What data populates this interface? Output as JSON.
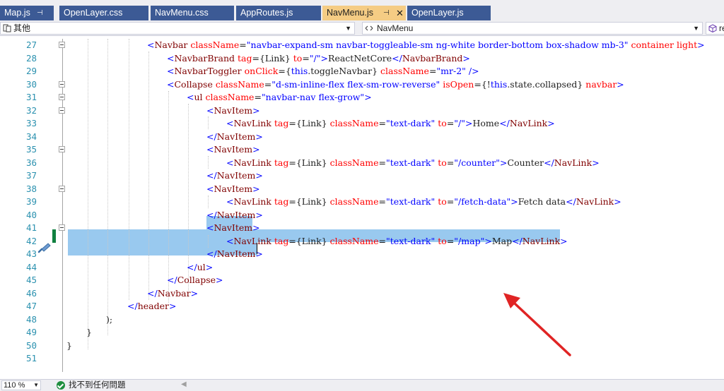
{
  "tabs": [
    {
      "label": "Map.js",
      "pinned": true,
      "active": false
    },
    {
      "label": "OpenLayer.css",
      "pinned": false,
      "active": false
    },
    {
      "label": "NavMenu.css",
      "pinned": false,
      "active": false
    },
    {
      "label": "AppRoutes.js",
      "pinned": false,
      "active": false
    },
    {
      "label": "NavMenu.js",
      "pinned": true,
      "active": true
    },
    {
      "label": "OpenLayer.js",
      "pinned": false,
      "active": false
    }
  ],
  "tab_glyphs": {
    "pin": "⊣",
    "close": "✕"
  },
  "navbar": {
    "project": "其他",
    "member": "NavMenu",
    "right": "re"
  },
  "code_lines": [
    {
      "n": "27",
      "fold": true,
      "tokens": [
        [
          "b",
          "<"
        ],
        [
          "tag",
          "Navbar"
        ],
        [
          "pn",
          " "
        ],
        [
          "attr",
          "className"
        ],
        [
          "pn",
          "="
        ],
        [
          "str",
          "\"navbar-expand-sm navbar-toggleable-sm ng-white border-bottom box-shadow mb-3\""
        ],
        [
          "pn",
          " "
        ],
        [
          "attr",
          "container"
        ],
        [
          "pn",
          " "
        ],
        [
          "attr",
          "light"
        ],
        [
          "b",
          ">"
        ]
      ]
    },
    {
      "n": "28",
      "fold": false,
      "tokens": [
        [
          "b",
          "<"
        ],
        [
          "tag",
          "NavbarBrand"
        ],
        [
          "pn",
          " "
        ],
        [
          "attr",
          "tag"
        ],
        [
          "pn",
          "={Link} "
        ],
        [
          "attr",
          "to"
        ],
        [
          "pn",
          "="
        ],
        [
          "str",
          "\"/\""
        ],
        [
          "b",
          ">"
        ],
        [
          "txt",
          "ReactNetCore"
        ],
        [
          "b",
          "</"
        ],
        [
          "tag",
          "NavbarBrand"
        ],
        [
          "b",
          ">"
        ]
      ]
    },
    {
      "n": "29",
      "fold": false,
      "tokens": [
        [
          "b",
          "<"
        ],
        [
          "tag",
          "NavbarToggler"
        ],
        [
          "pn",
          " "
        ],
        [
          "attr",
          "onClick"
        ],
        [
          "pn",
          "={"
        ],
        [
          "kw",
          "this"
        ],
        [
          "pn",
          ".toggleNavbar} "
        ],
        [
          "attr",
          "className"
        ],
        [
          "pn",
          "="
        ],
        [
          "str",
          "\"mr-2\""
        ],
        [
          "pn",
          " "
        ],
        [
          "b",
          "/>"
        ]
      ]
    },
    {
      "n": "30",
      "fold": true,
      "tokens": [
        [
          "b",
          "<"
        ],
        [
          "tag",
          "Collapse"
        ],
        [
          "pn",
          " "
        ],
        [
          "attr",
          "className"
        ],
        [
          "pn",
          "="
        ],
        [
          "str",
          "\"d-sm-inline-flex flex-sm-row-reverse\""
        ],
        [
          "pn",
          " "
        ],
        [
          "attr",
          "isOpen"
        ],
        [
          "pn",
          "={!"
        ],
        [
          "kw",
          "this"
        ],
        [
          "pn",
          ".state.collapsed} "
        ],
        [
          "attr",
          "navbar"
        ],
        [
          "b",
          ">"
        ]
      ]
    },
    {
      "n": "31",
      "fold": true,
      "tokens": [
        [
          "b",
          "<"
        ],
        [
          "tag",
          "ul"
        ],
        [
          "pn",
          " "
        ],
        [
          "attr",
          "className"
        ],
        [
          "pn",
          "="
        ],
        [
          "str",
          "\"navbar-nav flex-grow\""
        ],
        [
          "b",
          ">"
        ]
      ]
    },
    {
      "n": "32",
      "fold": true,
      "tokens": [
        [
          "b",
          "<"
        ],
        [
          "tag",
          "NavItem"
        ],
        [
          "b",
          ">"
        ]
      ]
    },
    {
      "n": "33",
      "fold": false,
      "tokens": [
        [
          "b",
          "<"
        ],
        [
          "tag",
          "NavLink"
        ],
        [
          "pn",
          " "
        ],
        [
          "attr",
          "tag"
        ],
        [
          "pn",
          "={Link} "
        ],
        [
          "attr",
          "className"
        ],
        [
          "pn",
          "="
        ],
        [
          "str",
          "\"text-dark\""
        ],
        [
          "pn",
          " "
        ],
        [
          "attr",
          "to"
        ],
        [
          "pn",
          "="
        ],
        [
          "str",
          "\"/\""
        ],
        [
          "b",
          ">"
        ],
        [
          "txt",
          "Home"
        ],
        [
          "b",
          "</"
        ],
        [
          "tag",
          "NavLink"
        ],
        [
          "b",
          ">"
        ]
      ]
    },
    {
      "n": "34",
      "fold": false,
      "tokens": [
        [
          "b",
          "</"
        ],
        [
          "tag",
          "NavItem"
        ],
        [
          "b",
          ">"
        ]
      ]
    },
    {
      "n": "35",
      "fold": true,
      "tokens": [
        [
          "b",
          "<"
        ],
        [
          "tag",
          "NavItem"
        ],
        [
          "b",
          ">"
        ]
      ]
    },
    {
      "n": "36",
      "fold": false,
      "tokens": [
        [
          "b",
          "<"
        ],
        [
          "tag",
          "NavLink"
        ],
        [
          "pn",
          " "
        ],
        [
          "attr",
          "tag"
        ],
        [
          "pn",
          "={Link} "
        ],
        [
          "attr",
          "className"
        ],
        [
          "pn",
          "="
        ],
        [
          "str",
          "\"text-dark\""
        ],
        [
          "pn",
          " "
        ],
        [
          "attr",
          "to"
        ],
        [
          "pn",
          "="
        ],
        [
          "str",
          "\"/counter\""
        ],
        [
          "b",
          ">"
        ],
        [
          "txt",
          "Counter"
        ],
        [
          "b",
          "</"
        ],
        [
          "tag",
          "NavLink"
        ],
        [
          "b",
          ">"
        ]
      ]
    },
    {
      "n": "37",
      "fold": false,
      "tokens": [
        [
          "b",
          "</"
        ],
        [
          "tag",
          "NavItem"
        ],
        [
          "b",
          ">"
        ]
      ]
    },
    {
      "n": "38",
      "fold": true,
      "tokens": [
        [
          "b",
          "<"
        ],
        [
          "tag",
          "NavItem"
        ],
        [
          "b",
          ">"
        ]
      ]
    },
    {
      "n": "39",
      "fold": false,
      "tokens": [
        [
          "b",
          "<"
        ],
        [
          "tag",
          "NavLink"
        ],
        [
          "pn",
          " "
        ],
        [
          "attr",
          "tag"
        ],
        [
          "pn",
          "={Link} "
        ],
        [
          "attr",
          "className"
        ],
        [
          "pn",
          "="
        ],
        [
          "str",
          "\"text-dark\""
        ],
        [
          "pn",
          " "
        ],
        [
          "attr",
          "to"
        ],
        [
          "pn",
          "="
        ],
        [
          "str",
          "\"/fetch-data\""
        ],
        [
          "b",
          ">"
        ],
        [
          "txt",
          "Fetch data"
        ],
        [
          "b",
          "</"
        ],
        [
          "tag",
          "NavLink"
        ],
        [
          "b",
          ">"
        ]
      ]
    },
    {
      "n": "40",
      "fold": false,
      "tokens": [
        [
          "b",
          "</"
        ],
        [
          "tag",
          "NavItem"
        ],
        [
          "b",
          ">"
        ]
      ]
    },
    {
      "n": "41",
      "fold": true,
      "tokens": [
        [
          "b",
          "<"
        ],
        [
          "tag",
          "NavItem"
        ],
        [
          "b",
          ">"
        ]
      ]
    },
    {
      "n": "42",
      "fold": false,
      "tokens": [
        [
          "b",
          "<"
        ],
        [
          "tag",
          "NavLink"
        ],
        [
          "pn",
          " "
        ],
        [
          "attr",
          "tag"
        ],
        [
          "pn",
          "={Link} "
        ],
        [
          "attr",
          "className"
        ],
        [
          "pn",
          "="
        ],
        [
          "str",
          "\"text-dark\""
        ],
        [
          "pn",
          " "
        ],
        [
          "attr",
          "to"
        ],
        [
          "pn",
          "="
        ],
        [
          "str",
          "\"/map\""
        ],
        [
          "b",
          ">"
        ],
        [
          "txt",
          "Map"
        ],
        [
          "b",
          "</"
        ],
        [
          "tag",
          "NavLink"
        ],
        [
          "b",
          ">"
        ]
      ]
    },
    {
      "n": "43",
      "fold": false,
      "tokens": [
        [
          "b",
          "</"
        ],
        [
          "tag",
          "NavItem"
        ],
        [
          "b",
          ">"
        ]
      ]
    },
    {
      "n": "44",
      "fold": false,
      "tokens": [
        [
          "b",
          "</"
        ],
        [
          "tag",
          "ul"
        ],
        [
          "b",
          ">"
        ]
      ]
    },
    {
      "n": "45",
      "fold": false,
      "tokens": [
        [
          "b",
          "</"
        ],
        [
          "tag",
          "Collapse"
        ],
        [
          "b",
          ">"
        ]
      ]
    },
    {
      "n": "46",
      "fold": false,
      "tokens": [
        [
          "b",
          "</"
        ],
        [
          "tag",
          "Navbar"
        ],
        [
          "b",
          ">"
        ]
      ]
    },
    {
      "n": "47",
      "fold": false,
      "tokens": [
        [
          "b",
          "</"
        ],
        [
          "tag",
          "header"
        ],
        [
          "b",
          ">"
        ]
      ]
    },
    {
      "n": "48",
      "fold": false,
      "tokens": [
        [
          "pn",
          ");"
        ]
      ]
    },
    {
      "n": "49",
      "fold": false,
      "tokens": [
        [
          "pn",
          "}"
        ]
      ]
    },
    {
      "n": "50",
      "fold": false,
      "tokens": [
        [
          "pn",
          "}"
        ]
      ]
    },
    {
      "n": "51",
      "fold": false,
      "tokens": []
    }
  ],
  "status": {
    "zoom": "110 %",
    "issues": "找不到任何問題"
  },
  "colors": {
    "tag": "#800000",
    "bracket": "#0000ff",
    "attribute": "#ff0000",
    "string": "#0000ff",
    "keyword": "#0000ff",
    "text": "#1e1e1e",
    "line_number": "#2b91af",
    "selection": "#99c9ef",
    "active_tab": "#f5cc84",
    "inactive_tab": "#3c5a95",
    "annotation_arrow": "#e02424"
  }
}
